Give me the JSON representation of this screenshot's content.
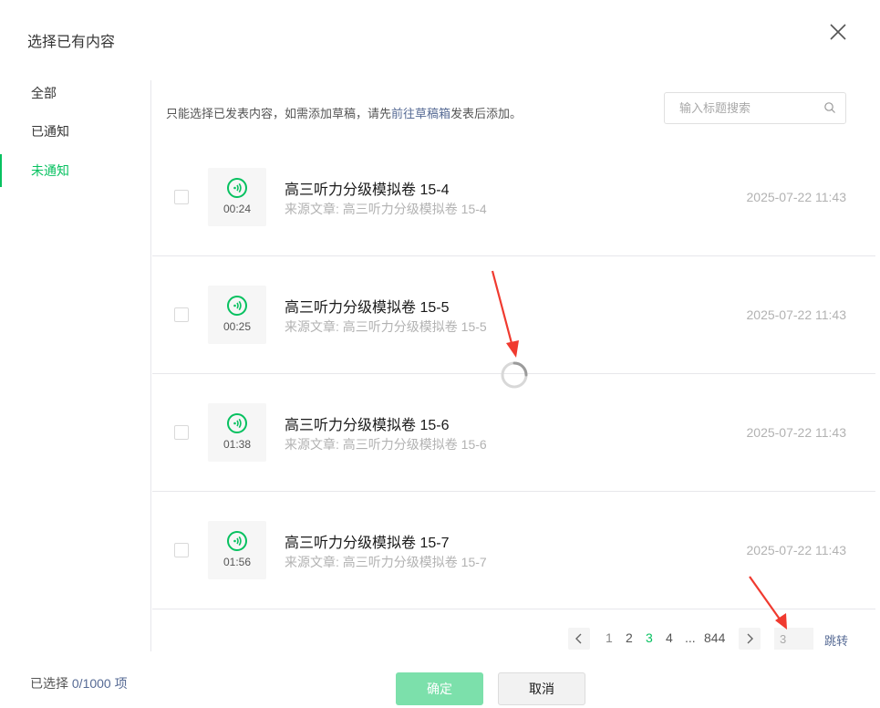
{
  "dialog": {
    "title": "选择已有内容",
    "close_icon": "close-icon"
  },
  "sidebar": {
    "items": [
      {
        "label": "全部",
        "active": false
      },
      {
        "label": "已通知",
        "active": false
      },
      {
        "label": "未通知",
        "active": true
      }
    ]
  },
  "tip": {
    "prefix": "只能选择已发表内容，如需添加草稿，请先",
    "link": "前往草稿箱",
    "suffix": "发表后添加。"
  },
  "search": {
    "placeholder": "输入标题搜索",
    "value": "",
    "icon": "search-icon"
  },
  "items": [
    {
      "title": "高三听力分级模拟卷 15-4",
      "source": "来源文章: 高三听力分级模拟卷 15-4",
      "duration": "00:24",
      "date": "2025-07-22 11:43",
      "icon": "audio-icon"
    },
    {
      "title": "高三听力分级模拟卷 15-5",
      "source": "来源文章: 高三听力分级模拟卷 15-5",
      "duration": "00:25",
      "date": "2025-07-22 11:43",
      "icon": "audio-icon"
    },
    {
      "title": "高三听力分级模拟卷 15-6",
      "source": "来源文章: 高三听力分级模拟卷 15-6",
      "duration": "01:38",
      "date": "2025-07-22 11:43",
      "icon": "audio-icon"
    },
    {
      "title": "高三听力分级模拟卷 15-7",
      "source": "来源文章: 高三听力分级模拟卷 15-7",
      "duration": "01:56",
      "date": "2025-07-22 11:43",
      "icon": "audio-icon"
    }
  ],
  "pagination": {
    "pages": [
      "1",
      "2",
      "3",
      "4"
    ],
    "current": "3",
    "ellipsis": "...",
    "last": "844",
    "input_value": "3",
    "jump_label": "跳转"
  },
  "footer": {
    "selected_label": "已选择",
    "selected_count": "0/1000 项",
    "confirm_label": "确定",
    "cancel_label": "取消"
  },
  "colors": {
    "accent": "#07c160",
    "link": "#576b95",
    "confirm_disabled": "#7ce0ab",
    "annotation_arrow": "#f03a2f"
  }
}
